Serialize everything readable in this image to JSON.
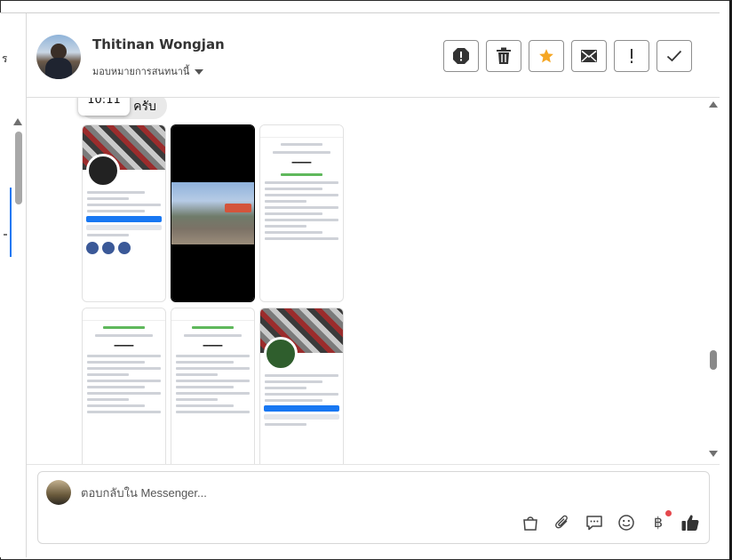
{
  "left_panel": {
    "partial_text": "ร"
  },
  "header": {
    "contact_name": "Thitinan Wongjan",
    "assign_label": "มอบหมายการสนทนานี้",
    "actions": [
      {
        "name": "report-icon"
      },
      {
        "name": "trash-icon"
      },
      {
        "name": "star-icon",
        "color": "#f5a623"
      },
      {
        "name": "mail-icon"
      },
      {
        "name": "exclamation-icon"
      },
      {
        "name": "check-icon"
      }
    ]
  },
  "conversation": {
    "message_partial": "ทำอยู่ ครับ",
    "tooltip_time": "10:11",
    "attachment_count": 6
  },
  "composer": {
    "placeholder": "ตอบกลับใน Messenger...",
    "currency_symbol": "฿",
    "tools": [
      "shopping-bag-icon",
      "paperclip-icon",
      "saved-reply-icon",
      "emoji-icon",
      "baht-icon",
      "thumbs-up-icon"
    ]
  },
  "colors": {
    "accent_blue": "#1877f2",
    "star": "#f5a623",
    "notification_dot": "#e5484d"
  }
}
